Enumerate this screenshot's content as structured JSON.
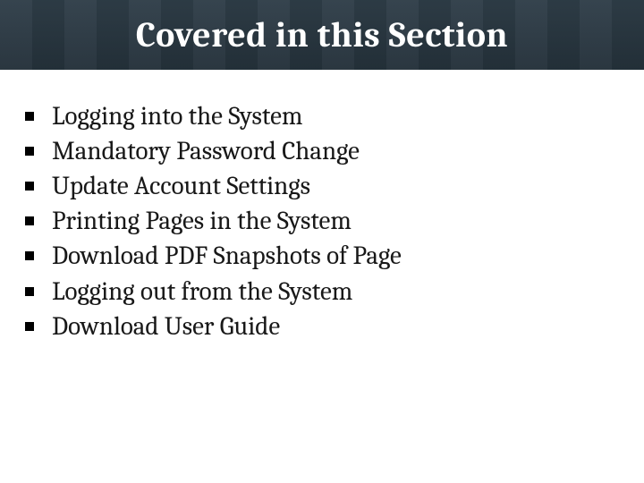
{
  "header": {
    "title": "Covered in this Section"
  },
  "bullets": [
    "Logging into the System",
    "Mandatory Password Change",
    "Update Account Settings",
    "Printing Pages in the System",
    "Download PDF Snapshots of Page",
    "Logging out from the System",
    "Download User Guide"
  ]
}
